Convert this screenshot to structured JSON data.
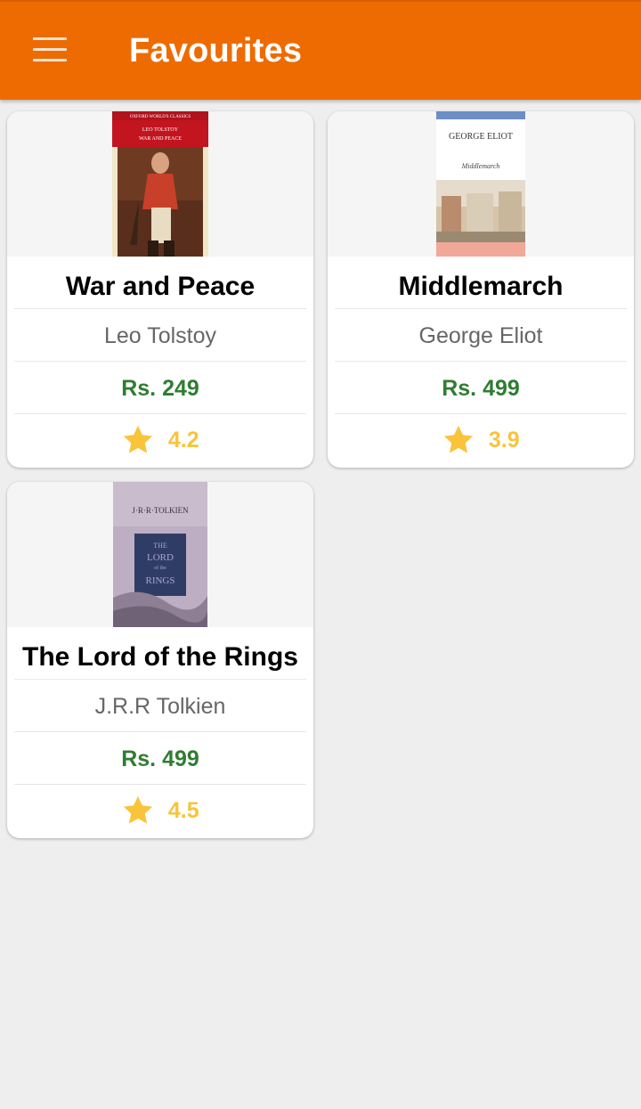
{
  "app": {
    "title": "Favourites",
    "accent_color": "#ee6b02"
  },
  "books": [
    {
      "title": "War and Peace",
      "author": "Leo Tolstoy",
      "price": "Rs. 249",
      "rating": "4.2",
      "cover": {
        "series": "OXFORD WORLD'S CLASSICS",
        "author": "LEO TOLSTOY",
        "title": "WAR AND PEACE"
      }
    },
    {
      "title": "Middlemarch",
      "author": "George Eliot",
      "price": "Rs. 499",
      "rating": "3.9",
      "cover": {
        "author": "GEORGE ELIOT",
        "title": "Middlemarch"
      }
    },
    {
      "title": "The Lord of the Rings",
      "author": "J.R.R Tolkien",
      "price": "Rs. 499",
      "rating": "4.5",
      "cover": {
        "author": "J·R·R·TOLKIEN",
        "title_line1": "THE",
        "title_line2": "LORD",
        "title_line3": "of the",
        "title_line4": "RINGS"
      }
    }
  ],
  "colors": {
    "price": "#2f7d32",
    "rating": "#f9c43a",
    "author": "#666666"
  }
}
